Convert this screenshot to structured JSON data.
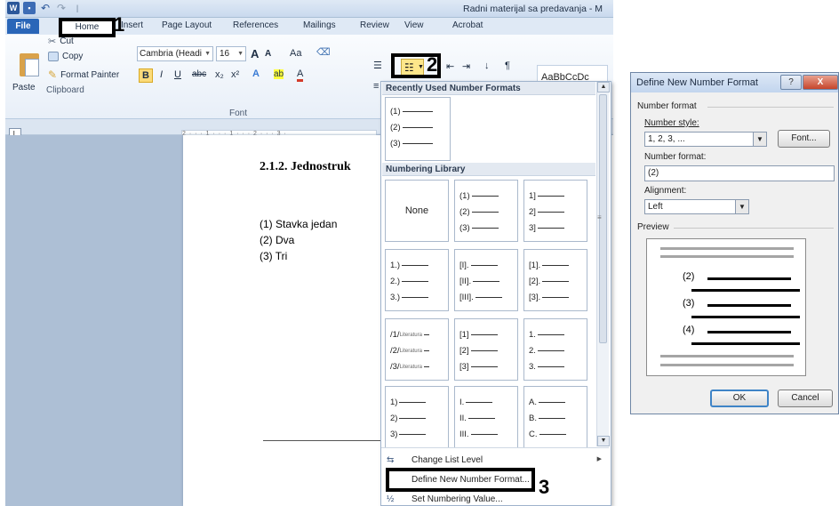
{
  "word": {
    "title": "Radni materijal sa predavanja - M",
    "quick_access": {
      "word_logo": "W",
      "undo_glyph": "↶",
      "redo_glyph": "↷",
      "separator": "|"
    },
    "tabs": [
      "File",
      "Home",
      "Insert",
      "Page Layout",
      "References",
      "Mailings",
      "Review",
      "View",
      "Acrobat"
    ],
    "clipboard": {
      "paste": "Paste",
      "cut": "Cut",
      "copy": "Copy",
      "format_painter": "Format Painter",
      "group_label": "Clipboard"
    },
    "font": {
      "font_name": "Cambria (Headi",
      "font_size": "16",
      "grow": "A",
      "shrink": "A",
      "change_case": "Aa",
      "bold": "B",
      "italic": "I",
      "underline": "U",
      "strikethrough": "abc",
      "subscript": "x₂",
      "superscript": "x²",
      "text_effects": "A",
      "highlight": "ab",
      "font_color": "A",
      "group_label": "Font"
    },
    "styles_preview": "AaBbCcDc",
    "ruler_marks": "2 · · · 1 · · · 1 · · · 2 · · · 3 ·",
    "document": {
      "heading": "2.1.2.  Jednostruk",
      "list": [
        "(1)  Stavka jedan",
        "(2)  Dva",
        "(3)  Tri"
      ]
    }
  },
  "numbering_menu": {
    "recent_header": "Recently Used Number Formats",
    "recent": [
      [
        "(1)",
        "(2)",
        "(3)"
      ]
    ],
    "library_header": "Numbering Library",
    "library": [
      {
        "none": "None"
      },
      [
        "(1)",
        "(2)",
        "(3)"
      ],
      [
        "1]",
        "2]",
        "3]"
      ],
      [
        "1.)",
        "2.)",
        "3.)"
      ],
      [
        "[I].",
        "[II].",
        "[III]."
      ],
      [
        "[1].",
        "[2].",
        "[3]."
      ],
      {
        "rows": [
          "/1/",
          "/2/",
          "/3/"
        ],
        "caption": "Literatura"
      },
      [
        "[1]",
        "[2]",
        "[3]"
      ],
      [
        "1.",
        "2.",
        "3."
      ],
      [
        "1)",
        "2)",
        "3)"
      ],
      [
        "I.",
        "II.",
        "III."
      ],
      [
        "A.",
        "B.",
        "C."
      ]
    ],
    "items": {
      "change_level": "Change List Level",
      "define_new": "Define New Number Format...",
      "set_value": "Set Numbering Value..."
    }
  },
  "annotations": {
    "one": "1",
    "two": "2",
    "three": "3"
  },
  "dialog": {
    "title": "Define New Number Format",
    "help": "?",
    "close": "X",
    "group": "Number format",
    "style_label": "Number style:",
    "style_value": "1, 2, 3, ...",
    "font_button": "Font...",
    "format_label": "Number format:",
    "format_value": "(2)",
    "alignment_label": "Alignment:",
    "alignment_value": "Left",
    "preview_label": "Preview",
    "preview_numbers": [
      "(2)",
      "(3)",
      "(4)"
    ],
    "ok": "OK",
    "cancel": "Cancel"
  },
  "colors": {
    "file_tab": "#2a66b8",
    "highlight": "#fde68a",
    "annotation": "#000000",
    "close_red": "#c6452b"
  }
}
